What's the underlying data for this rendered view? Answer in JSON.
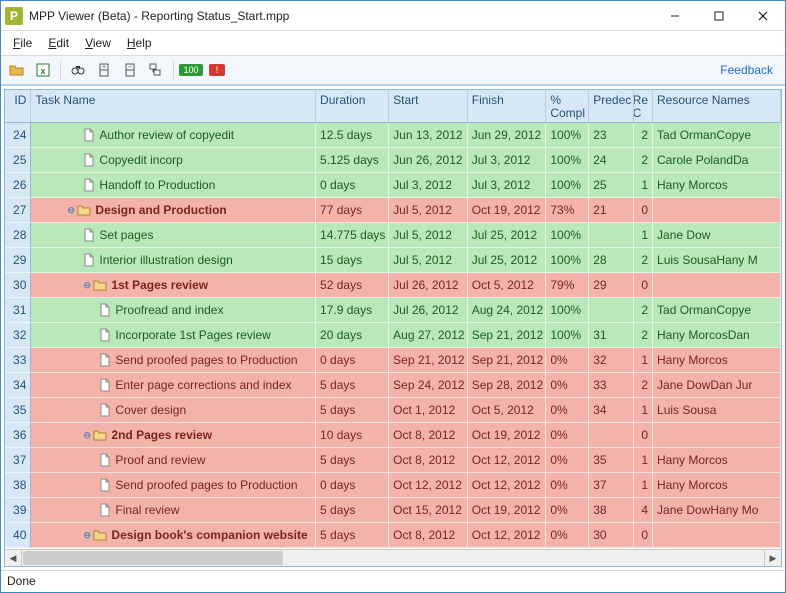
{
  "window": {
    "app_letter": "P",
    "title": "MPP Viewer (Beta) - Reporting Status_Start.mpp"
  },
  "menubar": [
    "File",
    "Edit",
    "View",
    "Help"
  ],
  "toolbar": {
    "feedback": "Feedback",
    "badge1": "100",
    "badge2": "!"
  },
  "header": {
    "id": "ID",
    "name": "Task Name",
    "dur": "Duration",
    "start": "Start",
    "finish": "Finish",
    "comp": "% Compl",
    "pred": "Predec",
    "rc": "Re C",
    "res": "Resource Names"
  },
  "rows": [
    {
      "id": "24",
      "kind": "doc",
      "indent": 3,
      "name": "Author review of copyedit",
      "dur": "12.5 days",
      "start": "Jun 13, 2012",
      "finish": "Jun 29, 2012",
      "comp": "100%",
      "pred": "23",
      "rc": "2",
      "res": "Tad OrmanCopye",
      "color": "green"
    },
    {
      "id": "25",
      "kind": "doc",
      "indent": 3,
      "name": "Copyedit incorp",
      "dur": "5.125 days",
      "start": "Jun 26, 2012",
      "finish": "Jul 3, 2012",
      "comp": "100%",
      "pred": "24",
      "rc": "2",
      "res": "Carole PolandDa",
      "color": "green"
    },
    {
      "id": "26",
      "kind": "doc",
      "indent": 3,
      "name": "Handoff to Production",
      "dur": "0 days",
      "start": "Jul 3, 2012",
      "finish": "Jul 3, 2012",
      "comp": "100%",
      "pred": "25",
      "rc": "1",
      "res": "Hany Morcos",
      "color": "green"
    },
    {
      "id": "27",
      "kind": "folder",
      "indent": 2,
      "name": "Design and Production",
      "dur": "77 days",
      "start": "Jul 5, 2012",
      "finish": "Oct 19, 2012",
      "comp": "73%",
      "pred": "21",
      "rc": "0",
      "res": "",
      "color": "red",
      "bold": true,
      "disclosure": true
    },
    {
      "id": "28",
      "kind": "doc",
      "indent": 3,
      "name": "Set pages",
      "dur": "14.775 days",
      "start": "Jul 5, 2012",
      "finish": "Jul 25, 2012",
      "comp": "100%",
      "pred": "",
      "rc": "1",
      "res": "Jane Dow",
      "color": "green"
    },
    {
      "id": "29",
      "kind": "doc",
      "indent": 3,
      "name": "Interior illustration design",
      "dur": "15 days",
      "start": "Jul 5, 2012",
      "finish": "Jul 25, 2012",
      "comp": "100%",
      "pred": "28",
      "rc": "2",
      "res": "Luis SousaHany M",
      "color": "green"
    },
    {
      "id": "30",
      "kind": "folder",
      "indent": 3,
      "name": "1st Pages review",
      "dur": "52 days",
      "start": "Jul 26, 2012",
      "finish": "Oct 5, 2012",
      "comp": "79%",
      "pred": "29",
      "rc": "0",
      "res": "",
      "color": "red",
      "bold": true,
      "disclosure": true
    },
    {
      "id": "31",
      "kind": "doc",
      "indent": 4,
      "name": "Proofread and index",
      "dur": "17.9 days",
      "start": "Jul 26, 2012",
      "finish": "Aug 24, 2012",
      "comp": "100%",
      "pred": "",
      "rc": "2",
      "res": "Tad OrmanCopye",
      "color": "green"
    },
    {
      "id": "32",
      "kind": "doc",
      "indent": 4,
      "name": "Incorporate 1st Pages review",
      "dur": "20 days",
      "start": "Aug 27, 2012",
      "finish": "Sep 21, 2012",
      "comp": "100%",
      "pred": "31",
      "rc": "2",
      "res": "Hany MorcosDan ",
      "color": "green"
    },
    {
      "id": "33",
      "kind": "doc",
      "indent": 4,
      "name": "Send proofed pages to Production",
      "dur": "0 days",
      "start": "Sep 21, 2012",
      "finish": "Sep 21, 2012",
      "comp": "0%",
      "pred": "32",
      "rc": "1",
      "res": "Hany Morcos",
      "color": "red"
    },
    {
      "id": "34",
      "kind": "doc",
      "indent": 4,
      "name": "Enter page corrections and index",
      "dur": "5 days",
      "start": "Sep 24, 2012",
      "finish": "Sep 28, 2012",
      "comp": "0%",
      "pred": "33",
      "rc": "2",
      "res": "Jane DowDan Jur",
      "color": "red"
    },
    {
      "id": "35",
      "kind": "doc",
      "indent": 4,
      "name": "Cover design",
      "dur": "5 days",
      "start": "Oct 1, 2012",
      "finish": "Oct 5, 2012",
      "comp": "0%",
      "pred": "34",
      "rc": "1",
      "res": "Luis Sousa",
      "color": "red"
    },
    {
      "id": "36",
      "kind": "folder",
      "indent": 3,
      "name": "2nd Pages review",
      "dur": "10 days",
      "start": "Oct 8, 2012",
      "finish": "Oct 19, 2012",
      "comp": "0%",
      "pred": "",
      "rc": "0",
      "res": "",
      "color": "red",
      "bold": true,
      "disclosure": true
    },
    {
      "id": "37",
      "kind": "doc",
      "indent": 4,
      "name": "Proof and review",
      "dur": "5 days",
      "start": "Oct 8, 2012",
      "finish": "Oct 12, 2012",
      "comp": "0%",
      "pred": "35",
      "rc": "1",
      "res": "Hany Morcos",
      "color": "red"
    },
    {
      "id": "38",
      "kind": "doc",
      "indent": 4,
      "name": "Send proofed pages to Production",
      "dur": "0 days",
      "start": "Oct 12, 2012",
      "finish": "Oct 12, 2012",
      "comp": "0%",
      "pred": "37",
      "rc": "1",
      "res": "Hany Morcos",
      "color": "red"
    },
    {
      "id": "39",
      "kind": "doc",
      "indent": 4,
      "name": "Final review",
      "dur": "5 days",
      "start": "Oct 15, 2012",
      "finish": "Oct 19, 2012",
      "comp": "0%",
      "pred": "38",
      "rc": "4",
      "res": "Jane DowHany Mo",
      "color": "red"
    },
    {
      "id": "40",
      "kind": "folder",
      "indent": 3,
      "name": "Design book's companion website",
      "dur": "5 days",
      "start": "Oct 8, 2012",
      "finish": "Oct 12, 2012",
      "comp": "0%",
      "pred": "30",
      "rc": "0",
      "res": "",
      "color": "red",
      "bold": true,
      "disclosure": true
    }
  ],
  "status": "Done"
}
